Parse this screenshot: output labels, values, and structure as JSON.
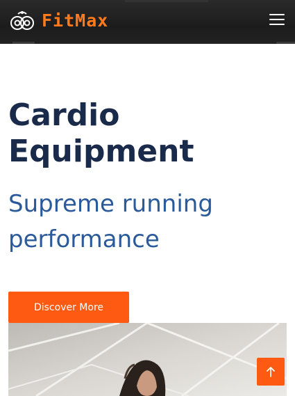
{
  "header": {
    "brand": "FitMax",
    "logo_icon": "dumbbell-plates-icon",
    "menu_icon": "hamburger-menu-icon"
  },
  "hero": {
    "title": "Cardio Equipment",
    "subtitle": "Supreme running performance",
    "cta_label": "Discover More"
  },
  "photo": {
    "subject": "athlete-photo"
  },
  "scroll_top_icon": "arrow-up-icon",
  "colors": {
    "accent": "#ff5a12",
    "brand_text": "#ff7a1a",
    "title": "#1a2a4a",
    "subtitle": "#2a5a9a",
    "header_bg": "#1f1f1f"
  }
}
